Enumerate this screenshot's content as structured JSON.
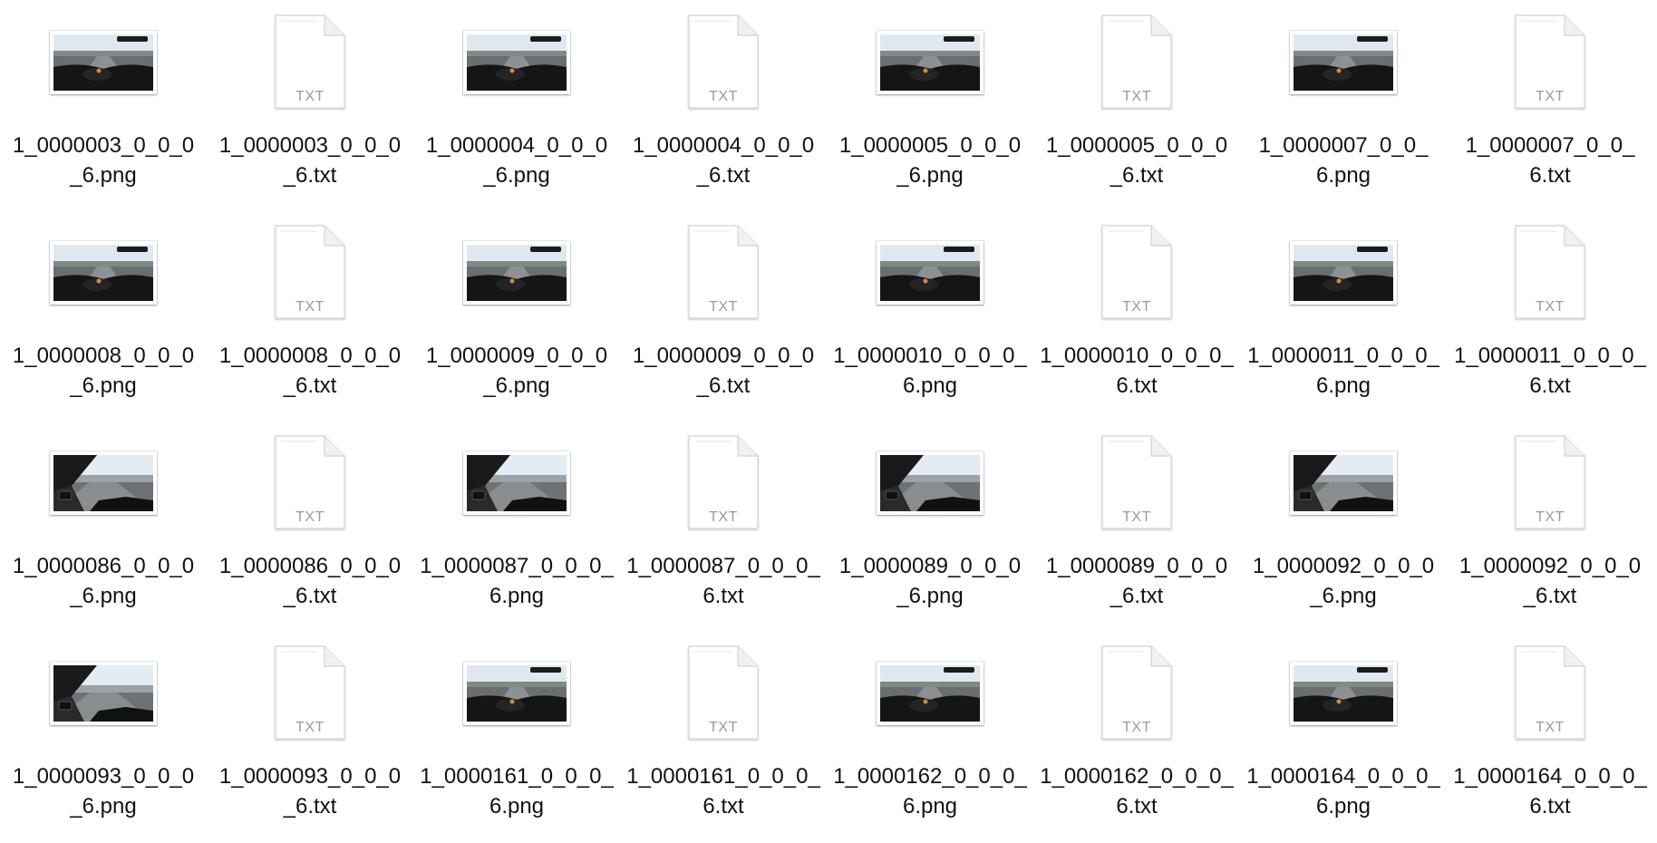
{
  "files": [
    {
      "type": "png",
      "scene": "straight",
      "line1": "1_0000003_0_0_0",
      "line2": "_6.png"
    },
    {
      "type": "txt",
      "icon_label": "TXT",
      "line1": "1_0000003_0_0_0",
      "line2": "_6.txt"
    },
    {
      "type": "png",
      "scene": "straight",
      "line1": "1_0000004_0_0_0",
      "line2": "_6.png"
    },
    {
      "type": "txt",
      "icon_label": "TXT",
      "line1": "1_0000004_0_0_0",
      "line2": "_6.txt"
    },
    {
      "type": "png",
      "scene": "straight",
      "line1": "1_0000005_0_0_0",
      "line2": "_6.png"
    },
    {
      "type": "txt",
      "icon_label": "TXT",
      "line1": "1_0000005_0_0_0",
      "line2": "_6.txt"
    },
    {
      "type": "png",
      "scene": "straight",
      "line1": "1_0000007_0_0_",
      "line2": "6.png"
    },
    {
      "type": "txt",
      "icon_label": "TXT",
      "line1": "1_0000007_0_0_",
      "line2": "6.txt"
    },
    {
      "type": "png",
      "scene": "straight",
      "line1": "1_0000008_0_0_0",
      "line2": "_6.png"
    },
    {
      "type": "txt",
      "icon_label": "TXT",
      "line1": "1_0000008_0_0_0",
      "line2": "_6.txt"
    },
    {
      "type": "png",
      "scene": "straight",
      "line1": "1_0000009_0_0_0",
      "line2": "_6.png"
    },
    {
      "type": "txt",
      "icon_label": "TXT",
      "line1": "1_0000009_0_0_0",
      "line2": "_6.txt"
    },
    {
      "type": "png",
      "scene": "straight",
      "line1": "1_0000010_0_0_0_",
      "line2": "6.png"
    },
    {
      "type": "txt",
      "icon_label": "TXT",
      "line1": "1_0000010_0_0_0_",
      "line2": "6.txt"
    },
    {
      "type": "png",
      "scene": "straight",
      "line1": "1_0000011_0_0_0_",
      "line2": "6.png"
    },
    {
      "type": "txt",
      "icon_label": "TXT",
      "line1": "1_0000011_0_0_0_",
      "line2": "6.txt"
    },
    {
      "type": "png",
      "scene": "turn",
      "line1": "1_0000086_0_0_0",
      "line2": "_6.png"
    },
    {
      "type": "txt",
      "icon_label": "TXT",
      "line1": "1_0000086_0_0_0",
      "line2": "_6.txt"
    },
    {
      "type": "png",
      "scene": "turn",
      "line1": "1_0000087_0_0_0_",
      "line2": "6.png"
    },
    {
      "type": "txt",
      "icon_label": "TXT",
      "line1": "1_0000087_0_0_0_",
      "line2": "6.txt"
    },
    {
      "type": "png",
      "scene": "turn",
      "line1": "1_0000089_0_0_0",
      "line2": "_6.png"
    },
    {
      "type": "txt",
      "icon_label": "TXT",
      "line1": "1_0000089_0_0_0",
      "line2": "_6.txt"
    },
    {
      "type": "png",
      "scene": "turn",
      "line1": "1_0000092_0_0_0",
      "line2": "_6.png"
    },
    {
      "type": "txt",
      "icon_label": "TXT",
      "line1": "1_0000092_0_0_0",
      "line2": "_6.txt"
    },
    {
      "type": "png",
      "scene": "turn",
      "line1": "1_0000093_0_0_0",
      "line2": "_6.png"
    },
    {
      "type": "txt",
      "icon_label": "TXT",
      "line1": "1_0000093_0_0_0",
      "line2": "_6.txt"
    },
    {
      "type": "png",
      "scene": "straight",
      "line1": "1_0000161_0_0_0_",
      "line2": "6.png"
    },
    {
      "type": "txt",
      "icon_label": "TXT",
      "line1": "1_0000161_0_0_0_",
      "line2": "6.txt"
    },
    {
      "type": "png",
      "scene": "straight",
      "line1": "1_0000162_0_0_0_",
      "line2": "6.png"
    },
    {
      "type": "txt",
      "icon_label": "TXT",
      "line1": "1_0000162_0_0_0_",
      "line2": "6.txt"
    },
    {
      "type": "png",
      "scene": "straight",
      "line1": "1_0000164_0_0_0_",
      "line2": "6.png"
    },
    {
      "type": "txt",
      "icon_label": "TXT",
      "line1": "1_0000164_0_0_0_",
      "line2": "6.txt"
    }
  ]
}
